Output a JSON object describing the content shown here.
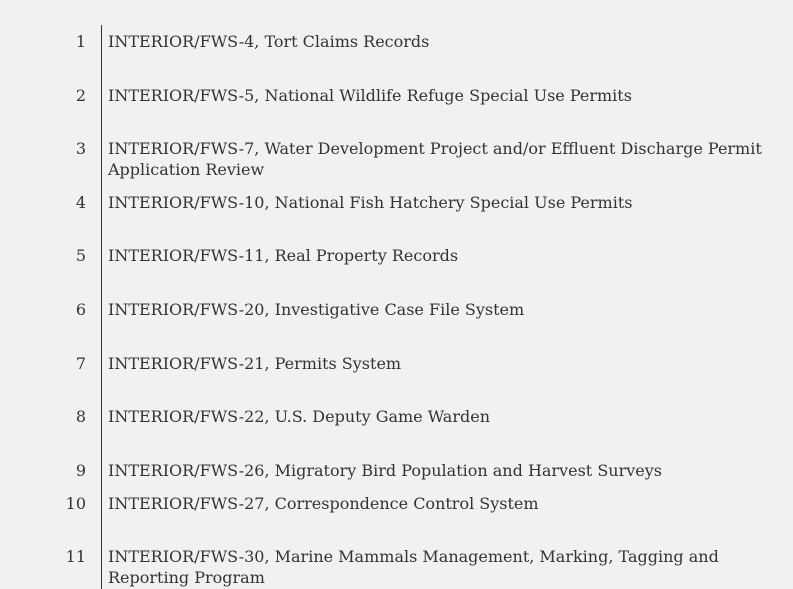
{
  "lines": [
    {
      "num": "1",
      "text": "INTERIOR/FWS-4, Tort Claims Records"
    },
    {
      "num": "2",
      "text": "INTERIOR/FWS-5, National Wildlife Refuge Special Use Permits"
    },
    {
      "num": "3",
      "text": "INTERIOR/FWS-7, Water Development Project and/or Effluent Discharge Permit Application Review"
    },
    {
      "num": "4",
      "text": "INTERIOR/FWS-10, National Fish Hatchery Special Use Permits"
    },
    {
      "num": "5",
      "text": "INTERIOR/FWS-11, Real Property Records"
    },
    {
      "num": "6",
      "text": "INTERIOR/FWS-20, Investigative Case File System"
    },
    {
      "num": "7",
      "text": "INTERIOR/FWS-21, Permits System"
    },
    {
      "num": "8",
      "text": "INTERIOR/FWS-22, U.S. Deputy Game Warden"
    },
    {
      "num": "9",
      "text": "INTERIOR/FWS-26, Migratory Bird Population and Harvest Surveys"
    },
    {
      "num": "10",
      "text": "INTERIOR/FWS-27, Correspondence Control System"
    },
    {
      "num": "11",
      "text": "INTERIOR/FWS-30, Marine Mammals Management, Marking, Tagging and Reporting Program"
    }
  ]
}
